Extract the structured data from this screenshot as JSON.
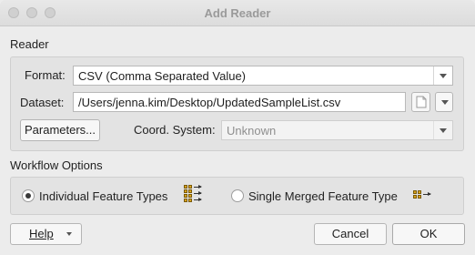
{
  "window": {
    "title": "Add Reader"
  },
  "reader": {
    "section_label": "Reader",
    "format_label": "Format:",
    "format_value": "CSV (Comma Separated Value)",
    "dataset_label": "Dataset:",
    "dataset_value": "/Users/jenna.kim/Desktop/UpdatedSampleList.csv",
    "parameters_label": "Parameters...",
    "coord_label": "Coord. System:",
    "coord_value": "Unknown"
  },
  "workflow": {
    "section_label": "Workflow Options",
    "option_individual": "Individual Feature Types",
    "option_merged": "Single Merged Feature Type",
    "selected": "individual"
  },
  "footer": {
    "help_label": "Help",
    "cancel_label": "Cancel",
    "ok_label": "OK"
  },
  "icons": [
    "close-icon",
    "minimize-icon",
    "zoom-icon",
    "file-browse-icon",
    "chevron-down-icon",
    "individual-feature-types-icon",
    "merged-feature-type-icon"
  ]
}
